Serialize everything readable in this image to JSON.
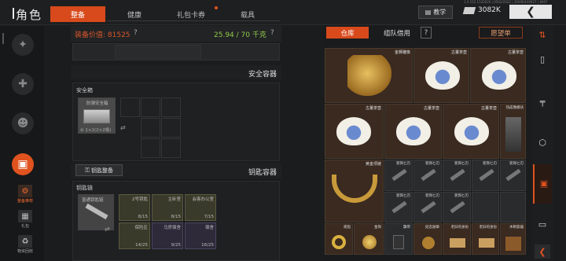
{
  "header": {
    "title": "角色",
    "version": "1.0.152.1520020 | 0502/2022 | 3009D4A9927 | 8497",
    "tabs": [
      {
        "label": "整备",
        "active": true
      },
      {
        "label": "健康",
        "active": false
      },
      {
        "label": "礼包卡券",
        "active": false,
        "badge": true
      },
      {
        "label": "载具",
        "active": false
      }
    ],
    "teach_label": "教学",
    "money": "3082K"
  },
  "sidebar": {
    "sub_items": [
      {
        "label": "整备推荐",
        "active": true
      },
      {
        "label": "礼包",
        "active": false
      },
      {
        "label": "物资回收",
        "active": false
      }
    ]
  },
  "center": {
    "value_label": "装备价值: 81525",
    "value_help": "?",
    "weight": "25.94 / 70 千克",
    "weight_help": "?",
    "safe_title": "安全容器",
    "safe_box_label": "安全箱",
    "safe_item_name": "防弹安全箱",
    "safe_item_sub": "⊘ 1×2(2×2格)",
    "key_tab_label": "钥匙整备",
    "key_title": "钥匙容器",
    "keychain_label": "钥匙链",
    "keychain_item": "普通钥匙链",
    "key_slots": [
      {
        "name": "2号钥匙",
        "count": "8/15"
      },
      {
        "name": "主卧室",
        "count": "8/15"
      },
      {
        "name": "会客办公室",
        "count": "7/15"
      },
      {
        "name": "保险区",
        "count": "14/25"
      },
      {
        "name": "马房宿舍",
        "count": "9/25"
      },
      {
        "name": "宿舍",
        "count": "16/25"
      }
    ]
  },
  "right": {
    "tab_warehouse": "仓库",
    "tab_team": "组队借用",
    "tab_help": "?",
    "tab_wishlist": "愿望单",
    "items": [
      {
        "name": "金狮雕像"
      },
      {
        "name": "古董茶壶"
      },
      {
        "name": "古董茶壶"
      },
      {
        "name": "古董茶壶"
      },
      {
        "name": "古董茶壶"
      },
      {
        "name": "古董茶壶"
      },
      {
        "name": "热成像模块"
      },
      {
        "name": "黄金项链"
      },
      {
        "name": "装饰匕刃"
      },
      {
        "name": "装饰匕刃"
      },
      {
        "name": "装饰匕刃"
      },
      {
        "name": "装饰匕刃"
      },
      {
        "name": "装饰匕刃"
      },
      {
        "name": "装饰匕刃"
      },
      {
        "name": "装饰匕刃"
      },
      {
        "name": "装饰匕刃"
      },
      {
        "name": "戒指"
      },
      {
        "name": "金饰"
      },
      {
        "name": "飘带"
      },
      {
        "name": "纪念勋章"
      },
      {
        "name": "老旧的身份"
      },
      {
        "name": "老旧的身份"
      },
      {
        "name": "木制容器"
      }
    ]
  },
  "colors": {
    "accent": "#e0531f",
    "weight": "#8fc94a",
    "value": "#d8562a"
  }
}
